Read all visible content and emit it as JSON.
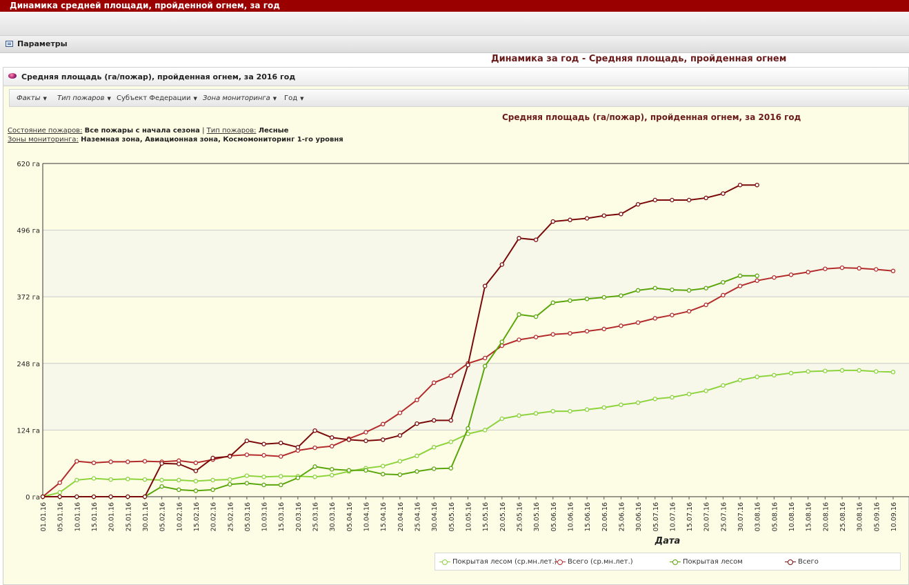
{
  "window": {
    "title": "Динамика средней площади, пройденной огнем, за год"
  },
  "params": {
    "label": "Параметры"
  },
  "report": {
    "title": "Динамика за год - Средняя площадь, пройденная огнем"
  },
  "panel": {
    "title": "Средняя площадь (га/пожар), пройденная огнем, за 2016 год"
  },
  "menu": [
    {
      "label": "Факты",
      "italic": true
    },
    {
      "label": "Тип пожаров",
      "italic": true
    },
    {
      "label": "Субъект Федерации",
      "italic": false
    },
    {
      "label": "Зона мониторинга",
      "italic": true
    },
    {
      "label": "Год",
      "italic": false
    }
  ],
  "filters": {
    "state_label": "Состояние пожаров:",
    "state_value": "Все пожары с начала сезона",
    "separator": "|",
    "type_label": "Тип пожаров:",
    "type_value": "Лесные",
    "zones_label": "Зоны мониторинга:",
    "zones_value": "Наземная зона, Авиационная зона, Космомониторинг 1-го уровня"
  },
  "colors": {
    "green": "#5aa60a",
    "red": "#7a0a0a",
    "green_avg": "#8cd33c",
    "red_avg": "#b32a2a"
  },
  "chart_data": {
    "type": "line",
    "title": "Средняя площадь (га/пожар), пройденная огнем, за 2016 год",
    "xlabel": "Дата",
    "ylabel": "",
    "y_unit": "га",
    "ylim": [
      0,
      620
    ],
    "y_ticks": [
      0,
      124,
      248,
      372,
      496,
      620
    ],
    "y_tick_labels": [
      "0 га",
      "124 га",
      "248 га",
      "372 га",
      "496 га",
      "620 га"
    ],
    "grid": true,
    "legend_position": "bottom-right",
    "x": [
      "01.01.16",
      "05.01.16",
      "10.01.16",
      "15.01.16",
      "20.01.16",
      "25.01.16",
      "30.01.16",
      "05.02.16",
      "10.02.16",
      "15.02.16",
      "20.02.16",
      "25.02.16",
      "05.03.16",
      "10.03.16",
      "15.03.16",
      "20.03.16",
      "25.03.16",
      "30.03.16",
      "05.04.16",
      "10.04.16",
      "15.04.16",
      "20.04.16",
      "25.04.16",
      "30.04.16",
      "05.05.16",
      "10.05.16",
      "15.05.16",
      "20.05.16",
      "25.05.16",
      "30.05.16",
      "05.06.16",
      "10.06.16",
      "15.06.16",
      "20.06.16",
      "25.06.16",
      "30.06.16",
      "05.07.16",
      "10.07.16",
      "15.07.16",
      "20.07.16",
      "25.07.16",
      "30.07.16",
      "03.08.16",
      "05.08.16",
      "10.08.16",
      "15.08.16",
      "20.08.16",
      "25.08.16",
      "30.08.16",
      "05.09.16",
      "10.09.16"
    ],
    "series": [
      {
        "name": "Покрытая лесом (ср.мн.лет.)",
        "color": "#8cd33c",
        "values": [
          0,
          8,
          31,
          34,
          32,
          33,
          32,
          31,
          31,
          29,
          31,
          32,
          39,
          37,
          38,
          38,
          37,
          40,
          47,
          53,
          57,
          66,
          76,
          92,
          102,
          117,
          124,
          145,
          151,
          155,
          159,
          159,
          162,
          166,
          171,
          175,
          182,
          185,
          191,
          197,
          207,
          217,
          223,
          226,
          230,
          233,
          234,
          235,
          235,
          233,
          232
        ]
      },
      {
        "name": "Всего (ср.мн.лет.)",
        "color": "#b32a2a",
        "values": [
          0,
          26,
          66,
          63,
          65,
          65,
          66,
          65,
          67,
          63,
          69,
          76,
          78,
          77,
          75,
          86,
          91,
          94,
          108,
          120,
          135,
          156,
          180,
          212,
          225,
          248,
          258,
          281,
          292,
          297,
          302,
          304,
          308,
          312,
          318,
          324,
          332,
          338,
          345,
          357,
          375,
          392,
          402,
          408,
          413,
          418,
          424,
          426,
          425,
          423,
          420
        ]
      },
      {
        "name": "Покрытая лесом",
        "color": "#5aa60a",
        "values": [
          0,
          0,
          0,
          0,
          0,
          0,
          0,
          19,
          13,
          11,
          13,
          23,
          25,
          22,
          22,
          35,
          56,
          51,
          49,
          49,
          42,
          41,
          47,
          52,
          53,
          127,
          243,
          288,
          339,
          335,
          361,
          365,
          368,
          371,
          374,
          384,
          388,
          385,
          384,
          388,
          399,
          411,
          411
        ]
      },
      {
        "name": "Всего",
        "color": "#7a0a0a",
        "values": [
          0,
          0,
          0,
          0,
          0,
          0,
          0,
          62,
          61,
          48,
          72,
          75,
          104,
          98,
          100,
          92,
          123,
          110,
          106,
          104,
          106,
          114,
          136,
          142,
          142,
          245,
          392,
          432,
          481,
          478,
          512,
          515,
          518,
          523,
          526,
          544,
          552,
          552,
          552,
          556,
          564,
          580,
          580
        ]
      }
    ]
  },
  "legend": [
    {
      "label": "Покрытая лесом (ср.мн.лет.)",
      "color": "#8cd33c"
    },
    {
      "label": "Всего (ср.мн.лет.)",
      "color": "#b32a2a"
    },
    {
      "label": "Покрытая лесом",
      "color": "#5aa60a"
    },
    {
      "label": "Всего",
      "color": "#7a0a0a"
    }
  ]
}
